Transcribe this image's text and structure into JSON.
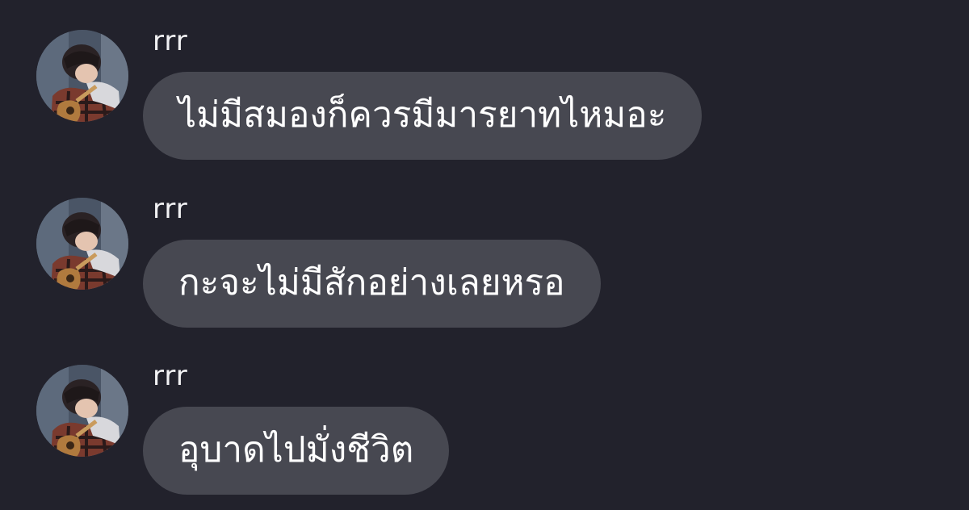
{
  "colors": {
    "background": "#22222c",
    "bubble": "#474851",
    "text": "#ffffff"
  },
  "messages": [
    {
      "sender": "rrr",
      "avatar": "profile-photo",
      "text": "ไม่มีสมองก็ควรมีมารยาทไหมอะ"
    },
    {
      "sender": "rrr",
      "avatar": "profile-photo",
      "text": "กะจะไม่มีสักอย่างเลยหรอ"
    },
    {
      "sender": "rrr",
      "avatar": "profile-photo",
      "text": "อุบาดไปมั่งชีวิต"
    }
  ]
}
